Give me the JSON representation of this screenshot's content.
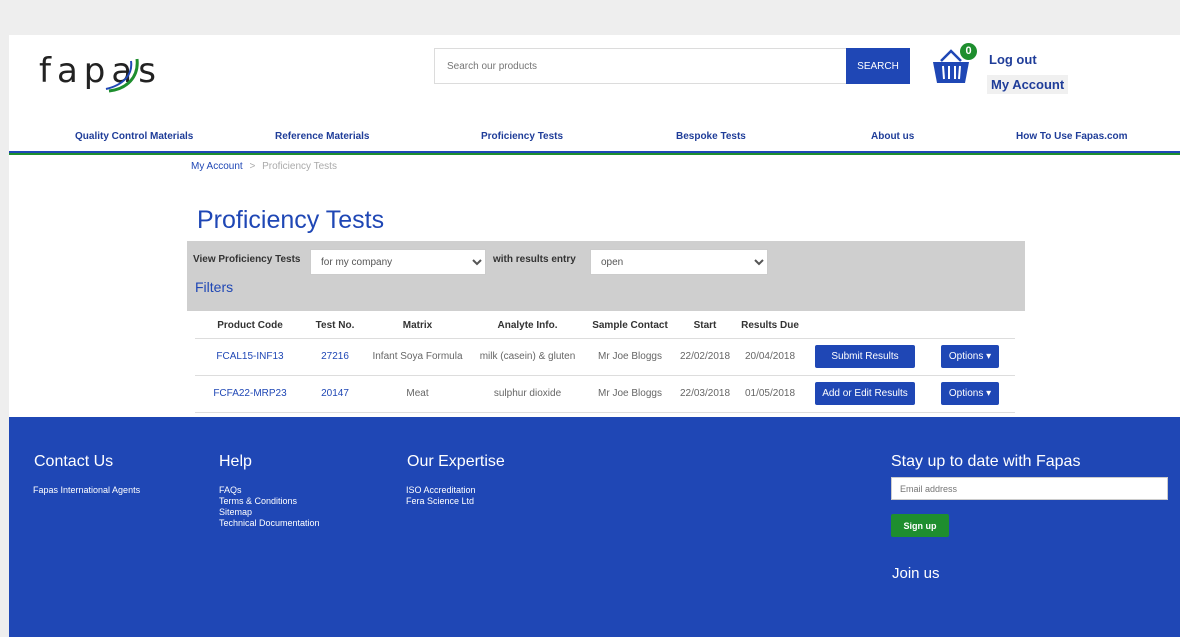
{
  "header": {
    "logo_text": "fapas",
    "search": {
      "placeholder": "Search our products",
      "button_label": "SEARCH"
    },
    "basket_count": "0",
    "logout_label": "Log out",
    "my_account_label": "My Account"
  },
  "nav": {
    "items": [
      {
        "label": "Quality Control Materials"
      },
      {
        "label": "Reference Materials"
      },
      {
        "label": "Proficiency Tests"
      },
      {
        "label": "Bespoke Tests"
      },
      {
        "label": "About us"
      },
      {
        "label": "How To Use Fapas.com"
      }
    ]
  },
  "breadcrumb": {
    "parent": "My Account",
    "separator": ">",
    "current": "Proficiency Tests"
  },
  "page_title": "Proficiency Tests",
  "filters": {
    "view_label": "View Proficiency Tests",
    "view_value": "for my company",
    "results_label": "with results entry",
    "results_value": "open",
    "filters_link": "Filters"
  },
  "table": {
    "columns": [
      "Product Code",
      "Test No.",
      "Matrix",
      "Analyte Info.",
      "Sample Contact",
      "Start",
      "Results Due"
    ],
    "rows": [
      {
        "product_code": "FCAL15-INF13",
        "test_no": "27216",
        "matrix": "Infant Soya Formula",
        "analyte": "milk (casein) & gluten",
        "contact": "Mr Joe Bloggs",
        "start": "22/02/2018",
        "due": "20/04/2018",
        "action": "Submit Results",
        "options": "Options"
      },
      {
        "product_code": "FCFA22-MRP23",
        "test_no": "20147",
        "matrix": "Meat",
        "analyte": "sulphur dioxide",
        "contact": "Mr Joe Bloggs",
        "start": "22/03/2018",
        "due": "01/05/2018",
        "action": "Add or Edit Results",
        "options": "Options"
      }
    ]
  },
  "footer": {
    "contact": {
      "title": "Contact Us",
      "links": [
        "Fapas International Agents"
      ]
    },
    "help": {
      "title": "Help",
      "links": [
        "FAQs",
        "Terms & Conditions",
        "Sitemap",
        "Technical Documentation"
      ]
    },
    "expertise": {
      "title": "Our Expertise",
      "links": [
        "ISO Accreditation",
        "Fera Science Ltd"
      ]
    },
    "newsletter": {
      "title": "Stay up to date with Fapas",
      "email_placeholder": "Email address",
      "signup_label": "Sign up"
    },
    "join_label": "Join us"
  },
  "colors": {
    "brand_blue": "#1f47b5",
    "brand_green": "#1e8e2e",
    "navy_text": "#1f3d99"
  }
}
